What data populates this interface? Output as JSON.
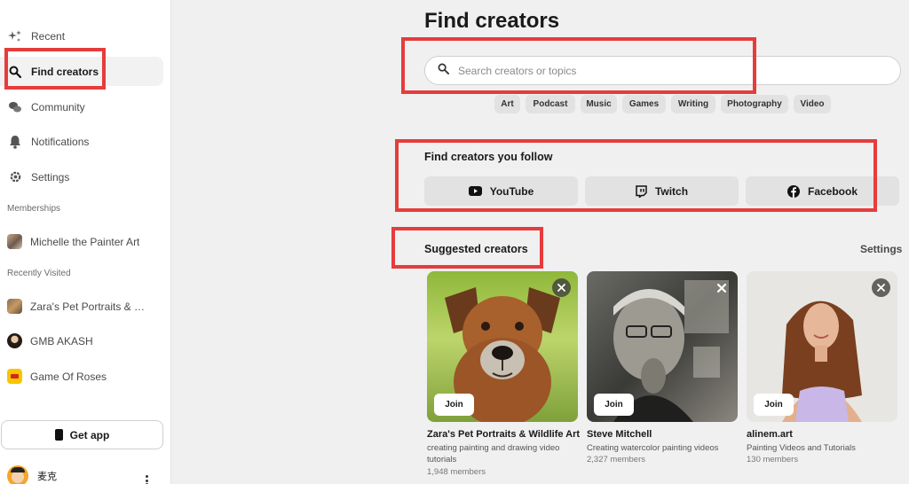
{
  "sidebar": {
    "nav": [
      {
        "label": "Recent",
        "icon": "sparkle-icon"
      },
      {
        "label": "Find creators",
        "icon": "search-icon"
      },
      {
        "label": "Community",
        "icon": "chat-bubbles-icon"
      },
      {
        "label": "Notifications",
        "icon": "bell-icon"
      },
      {
        "label": "Settings",
        "icon": "gear-icon"
      }
    ],
    "memberships_label": "Memberships",
    "memberships": [
      {
        "label": "Michelle the Painter Art"
      }
    ],
    "recently_visited_label": "Recently Visited",
    "recent": [
      {
        "label": "Zara's Pet Portraits & Wi..."
      },
      {
        "label": "GMB AKASH"
      },
      {
        "label": "Game Of Roses"
      }
    ],
    "get_app": "Get app",
    "user_name": "麦克"
  },
  "main": {
    "title": "Find creators",
    "search_placeholder": "Search creators or topics",
    "chips": [
      "Art",
      "Podcast",
      "Music",
      "Games",
      "Writing",
      "Photography",
      "Video"
    ],
    "follow_title": "Find creators you follow",
    "platforms": [
      {
        "label": "YouTube",
        "icon": "youtube-icon"
      },
      {
        "label": "Twitch",
        "icon": "twitch-icon"
      },
      {
        "label": "Facebook",
        "icon": "facebook-icon"
      }
    ],
    "suggested_title": "Suggested creators",
    "settings_label": "Settings",
    "creators": [
      {
        "name": "Zara's Pet Portraits & Wildlife Art",
        "desc": "creating painting and drawing video tutorials",
        "members": "1,948 members",
        "join": "Join"
      },
      {
        "name": "Steve Mitchell",
        "desc": "Creating watercolor painting videos",
        "members": "2,327 members",
        "join": "Join"
      },
      {
        "name": "alinem.art",
        "desc": "Painting Videos and Tutorials",
        "members": "130 members",
        "join": "Join"
      }
    ]
  },
  "colors": {
    "highlight": "#e63c3c",
    "chip_bg": "#e2e2e2",
    "page_bg": "#f0f0f0"
  }
}
